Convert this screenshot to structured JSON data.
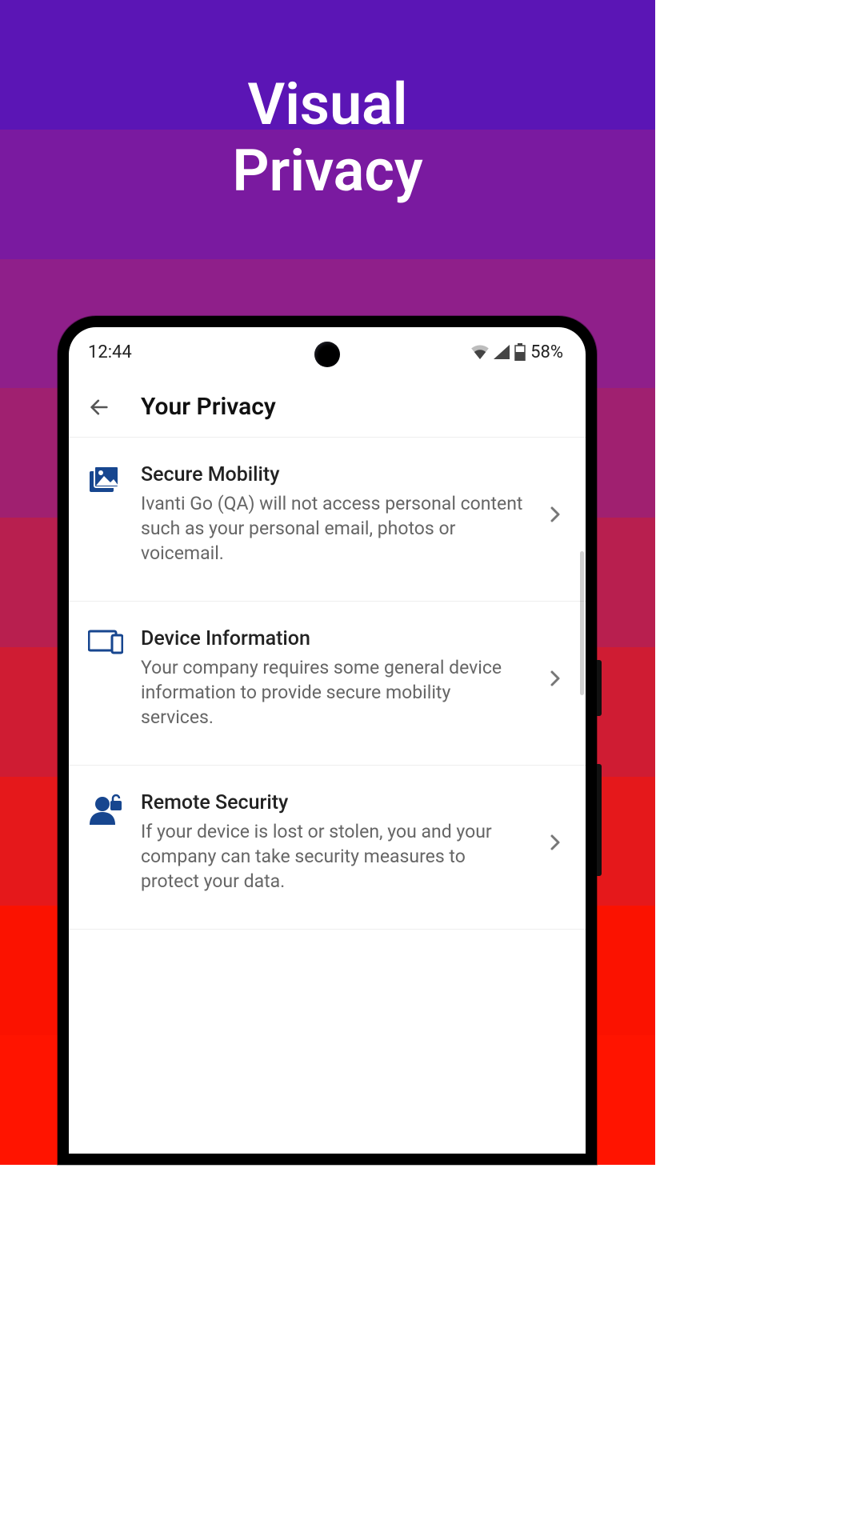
{
  "banner": {
    "title_line1": "Visual",
    "title_line2": "Privacy"
  },
  "bg_colors": [
    "#5b15b5",
    "#7a1aa0",
    "#8f1f8a",
    "#a02070",
    "#b81f4f",
    "#cf1c33",
    "#e5181b",
    "#fb1200",
    "#ff1400"
  ],
  "status": {
    "time": "12:44",
    "battery_text": "58%"
  },
  "page": {
    "title": "Your Privacy"
  },
  "rows": [
    {
      "icon": "media",
      "title": "Secure Mobility",
      "desc": "Ivanti Go (QA) will not access personal content such as your personal email, photos or voicemail."
    },
    {
      "icon": "devices",
      "title": "Device Information",
      "desc": "Your company requires some general device information to provide secure mobility services."
    },
    {
      "icon": "remote-security",
      "title": "Remote Security",
      "desc": "If your device is lost or stolen, you and your company can take security measures to protect your data."
    }
  ],
  "icon_color": "#17468f"
}
